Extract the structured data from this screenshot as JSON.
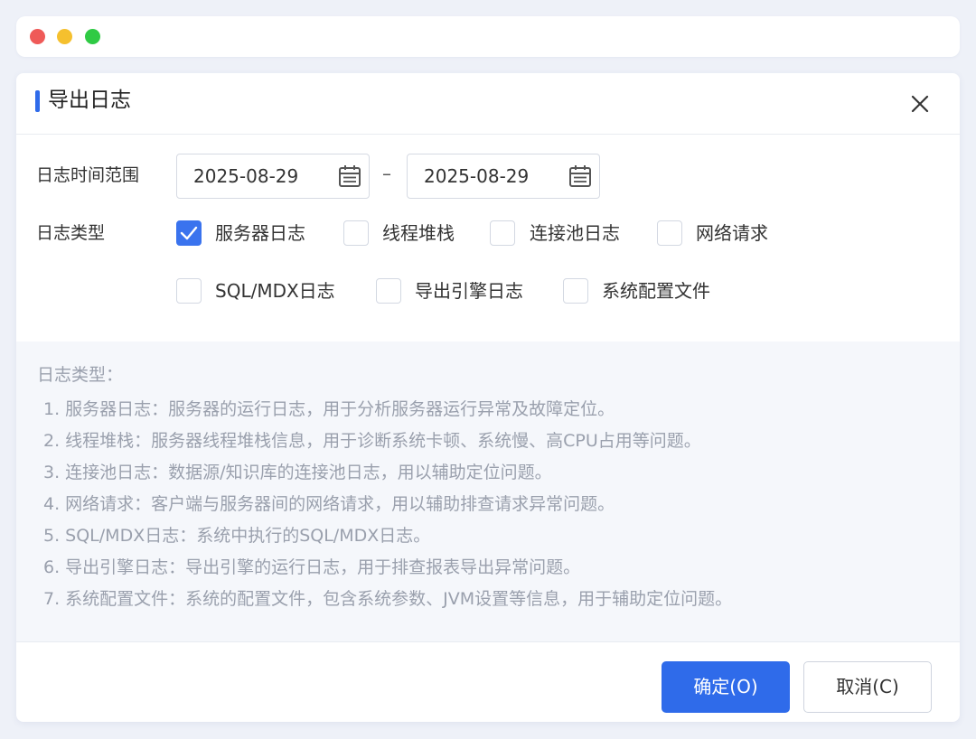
{
  "dialog": {
    "title": "导出日志"
  },
  "form": {
    "time_range_label": "日志时间范围",
    "start_date": "2025-08-29",
    "separator": "–",
    "end_date": "2025-08-29",
    "log_type_label": "日志类型",
    "log_types": [
      {
        "label": "服务器日志",
        "checked": true
      },
      {
        "label": "线程堆栈",
        "checked": false
      },
      {
        "label": "连接池日志",
        "checked": false
      },
      {
        "label": "网络请求",
        "checked": false
      },
      {
        "label": "SQL/MDX日志",
        "checked": false
      },
      {
        "label": "导出引擎日志",
        "checked": false
      },
      {
        "label": "系统配置文件",
        "checked": false
      }
    ]
  },
  "info": {
    "title": "日志类型：",
    "lines": [
      "1. 服务器日志：服务器的运行日志，用于分析服务器运行异常及故障定位。",
      "2. 线程堆栈：服务器线程堆栈信息，用于诊断系统卡顿、系统慢、高CPU占用等问题。",
      "3. 连接池日志：数据源/知识库的连接池日志，用以辅助定位问题。",
      "4. 网络请求：客户端与服务器间的网络请求，用以辅助排查请求异常问题。",
      "5. SQL/MDX日志：系统中执行的SQL/MDX日志。",
      "6. 导出引擎日志：导出引擎的运行日志，用于排查报表导出异常问题。",
      "7. 系统配置文件：系统的配置文件，包含系统参数、JVM设置等信息，用于辅助定位问题。"
    ]
  },
  "footer": {
    "confirm_label": "确定(O)",
    "cancel_label": "取消(C)"
  },
  "colors": {
    "accent": "#2f6bea",
    "checkbox_checked": "#3a73ee",
    "info_text": "#9aa0ad"
  }
}
